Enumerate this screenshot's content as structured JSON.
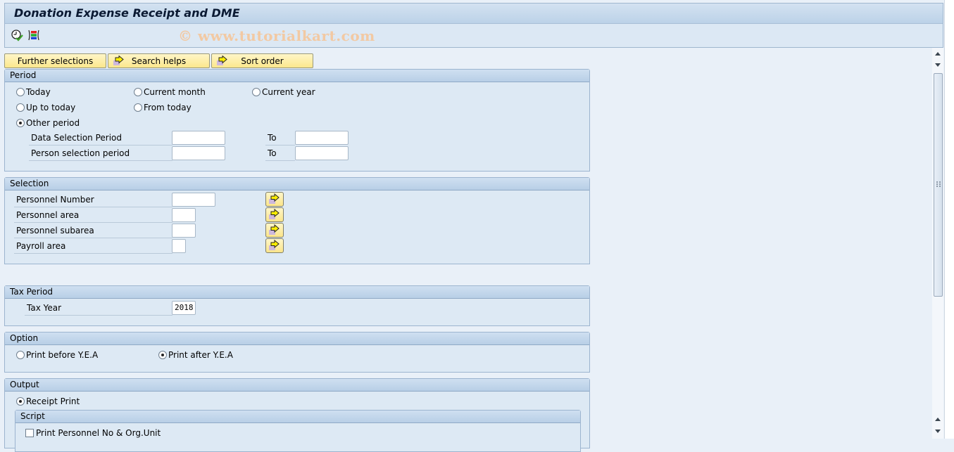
{
  "window": {
    "title": "Donation Expense Receipt and DME",
    "watermark": "© www.tutorialkart.com"
  },
  "toolbar": {
    "icons": [
      "execute-clock-icon",
      "variant-selection-icon"
    ]
  },
  "tabs": [
    {
      "label": "Further selections",
      "icon": null
    },
    {
      "label": "Search helps",
      "icon": "arrow-right-icon"
    },
    {
      "label": "Sort order",
      "icon": "arrow-right-icon"
    }
  ],
  "period": {
    "title": "Period",
    "options": [
      {
        "label": "Today",
        "selected": false
      },
      {
        "label": "Current month",
        "selected": false
      },
      {
        "label": "Current year",
        "selected": false
      },
      {
        "label": "Up to today",
        "selected": false
      },
      {
        "label": "From today",
        "selected": false
      },
      {
        "label": "Other period",
        "selected": true
      }
    ],
    "fields": [
      {
        "label": "Data Selection Period",
        "from": "",
        "to_label": "To",
        "to": ""
      },
      {
        "label": "Person selection period",
        "from": "",
        "to_label": "To",
        "to": ""
      }
    ]
  },
  "selection": {
    "title": "Selection",
    "fields": [
      {
        "label": "Personnel Number",
        "value": ""
      },
      {
        "label": "Personnel area",
        "value": ""
      },
      {
        "label": "Personnel subarea",
        "value": ""
      },
      {
        "label": "Payroll area",
        "value": ""
      }
    ]
  },
  "tax_period": {
    "title": "Tax Period",
    "tax_year_label": "Tax Year",
    "tax_year_value": "2018"
  },
  "option": {
    "title": "Option",
    "choices": [
      {
        "label": "Print before Y.E.A",
        "selected": false
      },
      {
        "label": "Print after Y.E.A",
        "selected": true
      }
    ]
  },
  "output": {
    "title": "Output",
    "receipt_print": {
      "label": "Receipt Print",
      "selected": true
    },
    "script": {
      "title": "Script",
      "checkbox_label": "Print Personnel No & Org.Unit",
      "checked": false
    }
  },
  "colors": {
    "button_yellow": "#fbe78c",
    "group_header": "#b8cfe6",
    "background": "#e9f0f8"
  }
}
